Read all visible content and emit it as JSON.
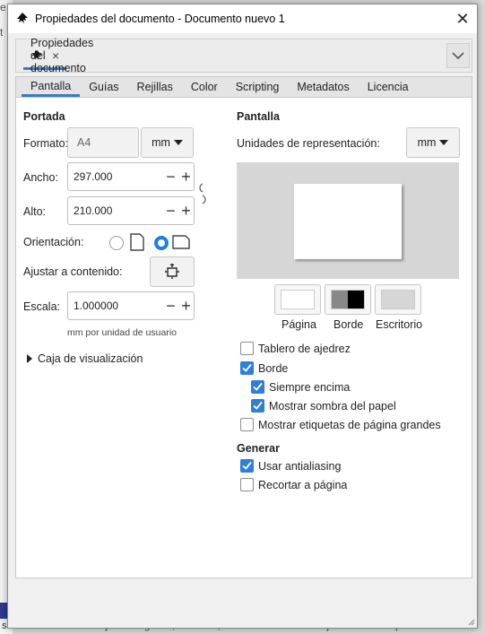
{
  "background": {
    "side_letters": [
      "e",
      "t"
    ],
    "status_text": "se han seleccionado objetos. Haga clic, Shift+clic, Alt+rueda encima de objetos o arrastre para seleccio"
  },
  "window": {
    "title": "Propiedades del documento - Documento nuevo 1"
  },
  "dock": {
    "tab_label": "Propiedades del documento",
    "close_glyph": "×"
  },
  "tabs": [
    "Pantalla",
    "Guías",
    "Rejillas",
    "Color",
    "Scripting",
    "Metadatos",
    "Licencia"
  ],
  "portada": {
    "heading": "Portada",
    "format_label": "Formato:",
    "format_value": "A4",
    "format_unit": "mm",
    "width_label": "Ancho:",
    "width_value": "297.000",
    "height_label": "Alto:",
    "height_value": "210.000",
    "orientation_label": "Orientación:",
    "fit_label": "Ajustar a contenido:",
    "scale_label": "Escala:",
    "scale_value": "1.000000",
    "scale_note": "mm por unidad de usuario",
    "viewbox_label": "Caja de visualización"
  },
  "pantalla": {
    "heading": "Pantalla",
    "units_label": "Unidades de representación:",
    "units_value": "mm",
    "swatch_labels": [
      "Página",
      "Borde",
      "Escritorio"
    ],
    "checkboxes": [
      {
        "label": "Tablero de ajedrez",
        "checked": false
      },
      {
        "label": "Borde",
        "checked": true
      },
      {
        "label": "Siempre encima",
        "checked": true
      },
      {
        "label": "Mostrar sombra del papel",
        "checked": true
      },
      {
        "label": "Mostrar etiquetas de página grandes",
        "checked": false
      }
    ]
  },
  "generar": {
    "heading": "Generar",
    "checkboxes": [
      {
        "label": "Usar antialiasing",
        "checked": true
      },
      {
        "label": "Recortar a página",
        "checked": false
      }
    ]
  },
  "colors": {
    "accent": "#2f7fd6",
    "tab_underline": "#3b7ac9"
  }
}
